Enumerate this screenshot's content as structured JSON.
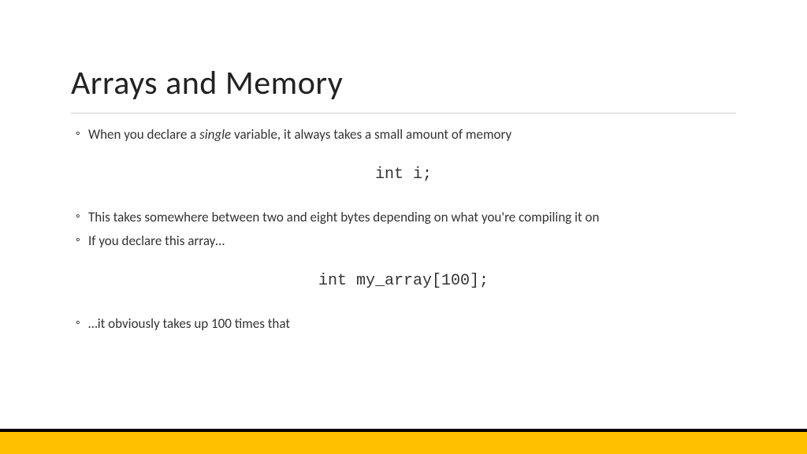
{
  "slide": {
    "title": "Arrays and Memory",
    "bullets": {
      "b1_pre": "When you declare a ",
      "b1_italic": "single",
      "b1_post": " variable, it always takes a small amount of memory",
      "b2": "This takes somewhere between two and eight bytes depending on what you're compiling it on",
      "b3": "If you declare this array…",
      "b4": "…it obviously takes up 100 times that"
    },
    "code": {
      "c1": "int i;",
      "c2": "int my_array[100];"
    }
  }
}
